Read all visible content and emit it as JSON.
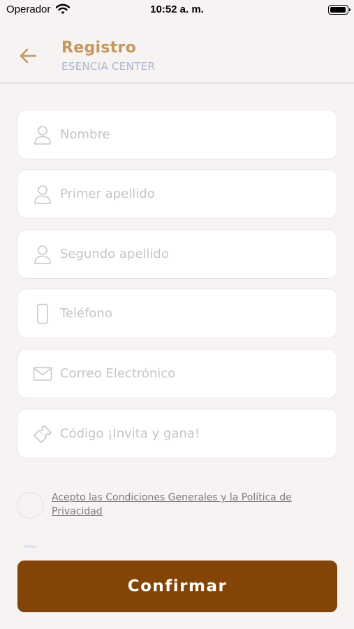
{
  "status_bar": {
    "carrier": "Operador",
    "time": "10:52 a. m."
  },
  "header": {
    "title": "Registro",
    "subtitle": "ESENCIA CENTER"
  },
  "form": {
    "fields": [
      {
        "placeholder": "Nombre",
        "value": "",
        "icon": "person-icon"
      },
      {
        "placeholder": "Primer apellido",
        "value": "",
        "icon": "person-icon"
      },
      {
        "placeholder": "Segundo apellido",
        "value": "",
        "icon": "person-icon"
      },
      {
        "placeholder": "Teléfono",
        "value": "",
        "icon": "phone-icon"
      },
      {
        "placeholder": "Correo Electrónico",
        "value": "",
        "icon": "mail-icon"
      },
      {
        "placeholder": "Código ¡Invita y gana!",
        "value": "",
        "icon": "ticket-icon"
      }
    ]
  },
  "terms": {
    "label": "Acepto las Condiciones Generales y la Política de Privacidad",
    "checked": false
  },
  "confirm_label": "Confirmar",
  "colors": {
    "accent": "#c4975f",
    "subtitle": "#a9b7d2",
    "button": "#834405",
    "background": "#f7f3f2"
  }
}
